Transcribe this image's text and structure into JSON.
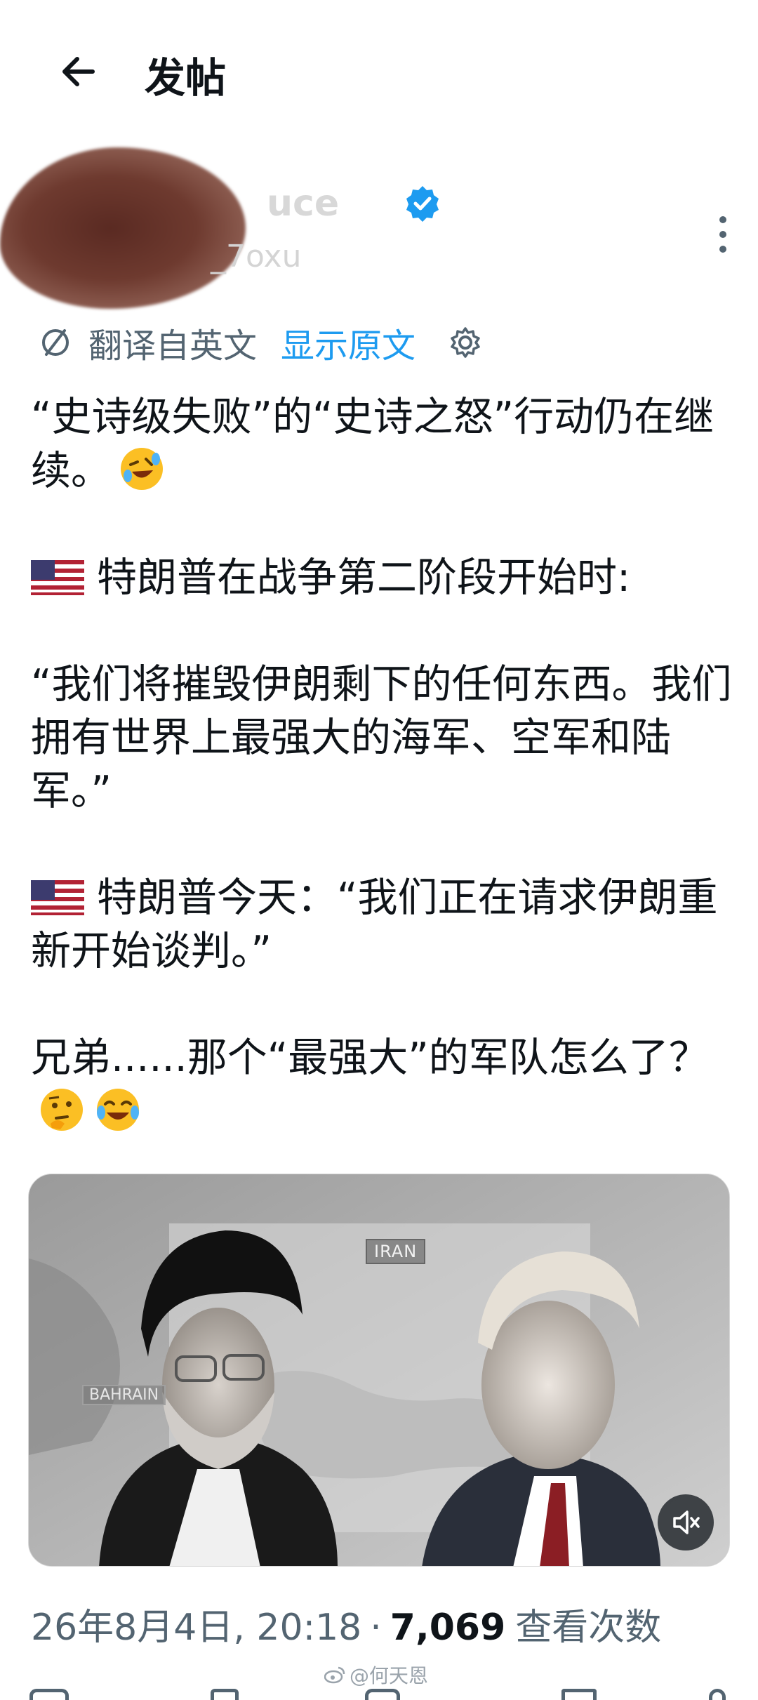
{
  "header": {
    "title": "发帖"
  },
  "author": {
    "name_visible": "uce",
    "handle_visible": "_7oxu"
  },
  "translation": {
    "label": "翻译自英文",
    "show_original": "显示原文"
  },
  "post": {
    "paragraphs": [
      "“史诗级失败”的“史诗之怒”行动仍在继续。",
      "特朗普在战争第二阶段开始时:",
      "“我们将摧毁伊朗剩下的任何东西。我们拥有世界上最强大的海军、空军和陆军。”",
      "特朗普今天：“我们正在请求伊朗重新开始谈判。”",
      "兄弟......那个“最强大”的军队怎么了？"
    ]
  },
  "media": {
    "map_label": "IRAN",
    "bahrain_label": "BAHRAIN"
  },
  "meta": {
    "timestamp": "26年8月4日, 20:18",
    "separator": "·",
    "views_count": "7,069",
    "views_label": "查看次数"
  },
  "watermark": {
    "text": "@何天恩"
  },
  "colors": {
    "accent": "#1d9bf0",
    "muted": "#536471",
    "text": "#0f1419"
  }
}
